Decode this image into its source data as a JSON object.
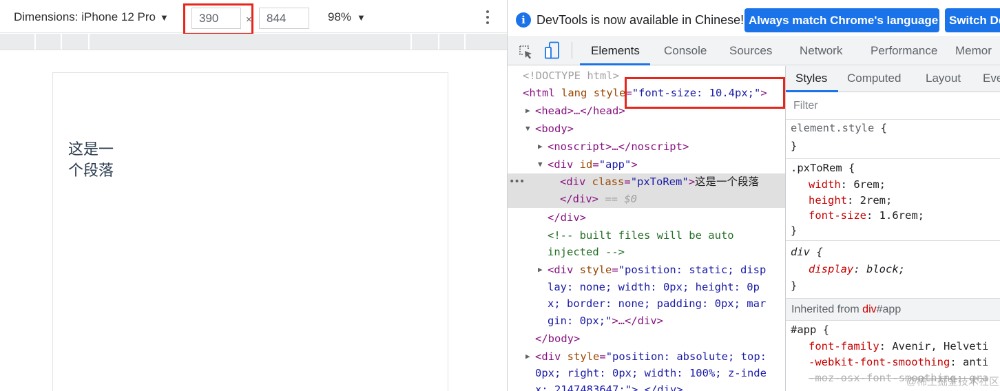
{
  "device_toolbar": {
    "dimensions_label": "Dimensions: iPhone 12 Pro",
    "width_value": "390",
    "times_sign": "×",
    "height_value": "844",
    "zoom_label": "98%",
    "menu_icon": "more-vertical-icon"
  },
  "page": {
    "paragraph": "这是一个段落"
  },
  "infobar": {
    "icon": "info-icon",
    "message": "DevTools is now available in Chinese!",
    "always_match_button": "Always match Chrome's language",
    "switch_button": "Switch De"
  },
  "devtools_tabs": {
    "icons": [
      "inspect-element-icon",
      "device-toggle-icon"
    ],
    "items": [
      "Elements",
      "Console",
      "Sources",
      "Network",
      "Performance",
      "Memor"
    ],
    "active": "Elements"
  },
  "dom_tree": {
    "doctype": "<!DOCTYPE html>",
    "html_open_tag": "<html",
    "html_attr_lang": "lang",
    "html_attr_style": "style",
    "html_style_value": "\"font-size: 10.4px;\"",
    "html_close_bracket": ">",
    "head": "<head>…</head>",
    "body_open": "<body>",
    "noscript": "<noscript>…</noscript>",
    "div_app_tag": "<div",
    "div_app_attr": "id",
    "div_app_value": "\"app\"",
    "div_pxtorem_tag": "<div",
    "div_pxtorem_attr": "class",
    "div_pxtorem_value": "\"pxToRem\"",
    "div_pxtorem_text": "这是一个段落",
    "div_close": "</div>",
    "selected_marker": "== $0",
    "div_app_close": "</div>",
    "comment_line1": "<!-- built files will be auto",
    "comment_line2": "injected -->",
    "div_static_tag": "<div",
    "div_static_attr": "style",
    "div_static_value_line1": "\"position: static; disp",
    "div_static_value_line2": "lay: none; width: 0px; height: 0p",
    "div_static_value_line3": "x; border: none; padding: 0px; mar",
    "div_static_value_line4": "gin: 0px;\"",
    "div_static_tail": ">…</div>",
    "body_close": "</body>",
    "div_abs_tag": "<div",
    "div_abs_attr": "style",
    "div_abs_value_line1": "\"position: absolute; top:",
    "div_abs_value_line2": "0px; right: 0px; width: 100%; z-inde",
    "div_abs_value_line3": "x: 2147483647;\">…</div>"
  },
  "styles": {
    "tabs": [
      "Styles",
      "Computed",
      "Layout",
      "Eve"
    ],
    "active_tab": "Styles",
    "filter_placeholder": "Filter",
    "element_style_selector": "element.style",
    "open_brace": "{",
    "close_brace": "}",
    "pxtorem_selector": ".pxToRem",
    "pxtorem_props": [
      {
        "name": "width",
        "value": "6rem"
      },
      {
        "name": "height",
        "value": "2rem"
      },
      {
        "name": "font-size",
        "value": "1.6rem"
      }
    ],
    "div_selector": "div",
    "div_props": [
      {
        "name": "display",
        "value": "block"
      }
    ],
    "inherited_label": "Inherited from",
    "inherited_tag": "div",
    "inherited_id": "#app",
    "app_selector": "#app",
    "app_props": [
      {
        "name": "font-family",
        "value": "Avenir, Helveti"
      },
      {
        "name": "-webkit-font-smoothing",
        "value": "anti"
      },
      {
        "name": "-moz-osx-font-smoothing",
        "value": "gra"
      }
    ]
  },
  "watermark": "@稀土掘金技术社区"
}
